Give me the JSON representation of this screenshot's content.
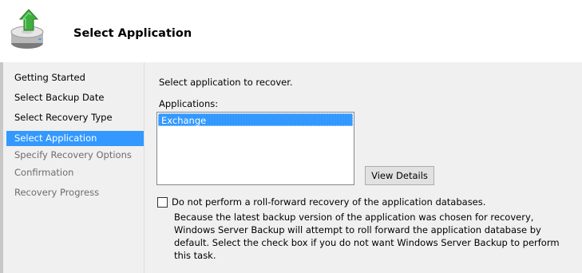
{
  "header": {
    "title": "Select Application",
    "icon": "backup-restore-icon"
  },
  "nav": {
    "items": [
      {
        "label": "Getting Started",
        "state": "enabled"
      },
      {
        "label": "Select Backup Date",
        "state": "enabled"
      },
      {
        "label": "Select Recovery Type",
        "state": "enabled"
      },
      {
        "label": "Select Application",
        "state": "selected"
      },
      {
        "label": "Specify Recovery Options",
        "state": "disabled"
      },
      {
        "label": "Confirmation",
        "state": "disabled"
      },
      {
        "label": "Recovery Progress",
        "state": "disabled"
      }
    ]
  },
  "main": {
    "instruction": "Select application to recover.",
    "applications_label": "Applications:",
    "applications": [
      "Exchange"
    ],
    "selected_application": "Exchange",
    "view_details_label": "View Details",
    "rollforward_checkbox_label": "Do not perform a roll-forward recovery of the application databases.",
    "rollforward_checked": false,
    "description": "Because the latest backup version of the application was chosen for recovery, Windows Server Backup will attempt to roll forward the application database by default. Select the check box if you do not want Windows Server Backup to perform this task."
  },
  "colors": {
    "selection": "#3399ff",
    "panel": "#f0f0f0",
    "disabled_text": "#6d6d6d"
  }
}
